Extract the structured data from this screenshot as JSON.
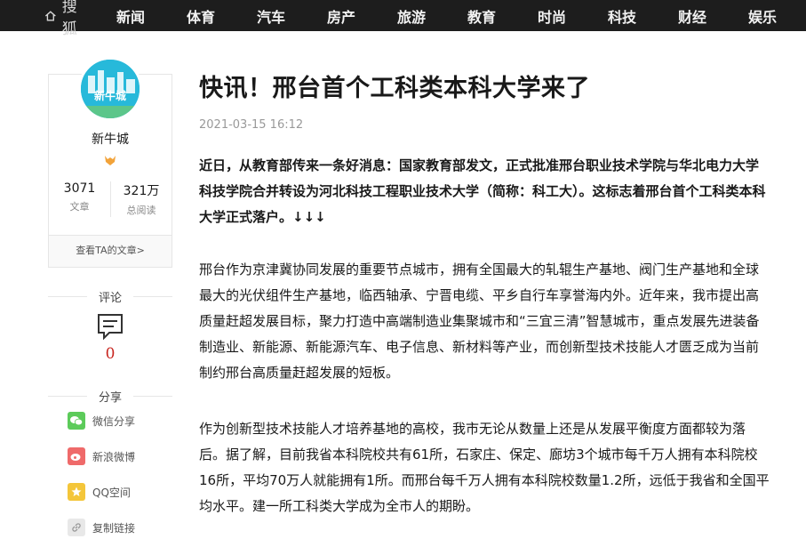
{
  "nav": {
    "logo": "搜狐",
    "items": [
      "新闻",
      "体育",
      "汽车",
      "房产",
      "旅游",
      "教育",
      "时尚",
      "科技",
      "财经",
      "娱乐"
    ]
  },
  "author": {
    "avatar_text": "新牛城",
    "name": "新牛城",
    "articles_count": "3071",
    "articles_label": "文章",
    "reads_count": "321万",
    "reads_label": "总阅读",
    "view_link": "查看TA的文章>"
  },
  "comment": {
    "title": "评论",
    "count": "0"
  },
  "share": {
    "title": "分享",
    "items": [
      "微信分享",
      "新浪微博",
      "QQ空间",
      "复制链接"
    ]
  },
  "article": {
    "title": "快讯！邢台首个工科类本科大学来了",
    "date": "2021-03-15 16:12",
    "lead": "近日，从教育部传来一条好消息：国家教育部发文，正式批准邢台职业技术学院与华北电力大学科技学院合并转设为河北科技工程职业技术大学（简称：科工大）。这标志着邢台首个工科类本科大学正式落户。↓↓↓",
    "p1": "邢台作为京津冀协同发展的重要节点城市，拥有全国最大的轧辊生产基地、阀门生产基地和全球最大的光伏组件生产基地，临西轴承、宁晋电缆、平乡自行车享誉海内外。近年来，我市提出高质量赶超发展目标，聚力打造中高端制造业集聚城市和“三宜三清”智慧城市，重点发展先进装备制造业、新能源、新能源汽车、电子信息、新材料等产业，而创新型技术技能人才匮乏成为当前制约邢台高质量赶超发展的短板。",
    "p2": "作为创新型技术技能人才培养基地的高校，我市无论从数量上还是从发展平衡度方面都较为落后。据了解，目前我省本科院校共有61所，石家庄、保定、廊坊3个城市每千万人拥有本科院校16所，平均70万人就能拥有1所。而邢台每千万人拥有本科院校数量1.2所，远低于我省和全国平均水平。建一所工科类大学成为全市人的期盼。"
  }
}
